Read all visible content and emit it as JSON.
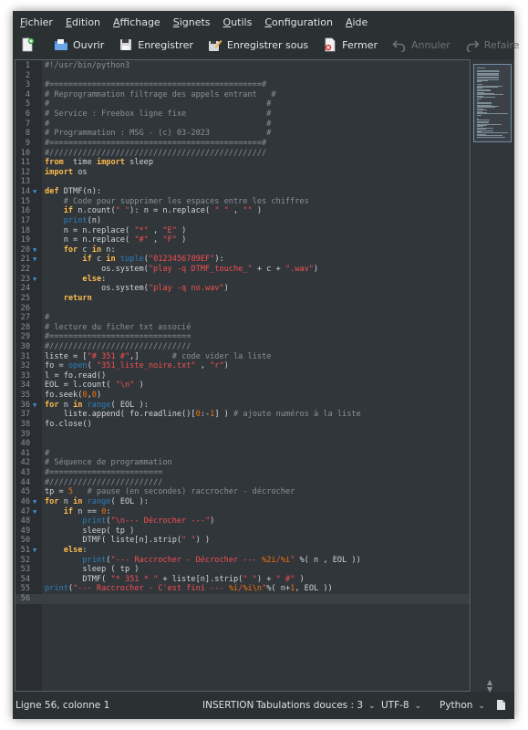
{
  "menu": [
    "Fichier",
    "Edition",
    "Affichage",
    "Signets",
    "Outils",
    "Configuration",
    "Aide"
  ],
  "toolbar": {
    "new": {
      "label": "",
      "icon": "new-document-icon"
    },
    "open": {
      "label": "Ouvrir",
      "icon": "open-folder-icon"
    },
    "save": {
      "label": "Enregistrer",
      "icon": "save-icon"
    },
    "save_as": {
      "label": "Enregistrer sous",
      "icon": "save-as-icon"
    },
    "close": {
      "label": "Fermer",
      "icon": "close-document-icon"
    },
    "undo": {
      "label": "Annuler",
      "icon": "undo-icon"
    },
    "redo": {
      "label": "Refaire",
      "icon": "redo-icon"
    }
  },
  "editor": {
    "current_line": 56,
    "lines": [
      {
        "n": "1",
        "t": [
          [
            "cm",
            "#!/usr/bin/python3"
          ]
        ]
      },
      {
        "n": "2",
        "t": []
      },
      {
        "n": "3",
        "t": [
          [
            "cm",
            "#=============================================#"
          ]
        ]
      },
      {
        "n": "4",
        "t": [
          [
            "cm",
            "# Reprogrammation filtrage des appels entrant   #"
          ]
        ]
      },
      {
        "n": "5",
        "t": [
          [
            "cm",
            "#                                              #"
          ]
        ]
      },
      {
        "n": "6",
        "t": [
          [
            "cm",
            "# Service : Freebox ligne fixe                 #"
          ]
        ]
      },
      {
        "n": "7",
        "t": [
          [
            "cm",
            "#                                              #"
          ]
        ]
      },
      {
        "n": "8",
        "t": [
          [
            "cm",
            "# Programmation : MSG - (c) 03-2023            #"
          ]
        ]
      },
      {
        "n": "9",
        "t": [
          [
            "cm",
            "#=============================================#"
          ]
        ]
      },
      {
        "n": "10",
        "t": [
          [
            "cm",
            "#//////////////////////////////////////////////"
          ]
        ]
      },
      {
        "n": "11",
        "t": [
          [
            "kw",
            "from"
          ],
          [
            "",
            "  time "
          ],
          [
            "kw",
            "import"
          ],
          [
            "",
            " sleep"
          ]
        ]
      },
      {
        "n": "12",
        "t": [
          [
            "kw",
            "import"
          ],
          [
            "",
            " os"
          ]
        ]
      },
      {
        "n": "13",
        "t": []
      },
      {
        "n": "14",
        "fold": true,
        "t": [
          [
            "kw",
            "def"
          ],
          [
            "",
            " DTMF(n):"
          ]
        ]
      },
      {
        "n": "15",
        "t": [
          [
            "",
            "    "
          ],
          [
            "cm",
            "# Code pour supprimer les espaces entre les chiffres"
          ]
        ]
      },
      {
        "n": "16",
        "t": [
          [
            "",
            "    "
          ],
          [
            "kw",
            "if"
          ],
          [
            "",
            " n.count("
          ],
          [
            "str",
            "\" \""
          ],
          [
            "",
            "): n = n.replace( "
          ],
          [
            "str",
            "\" \""
          ],
          [
            "",
            " , "
          ],
          [
            "str",
            "\"\""
          ],
          [
            "",
            " )"
          ]
        ]
      },
      {
        "n": "17",
        "t": [
          [
            "",
            "    "
          ],
          [
            "bi",
            "print"
          ],
          [
            "",
            "(n)"
          ]
        ]
      },
      {
        "n": "18",
        "t": [
          [
            "",
            "    n = n.replace( "
          ],
          [
            "str",
            "\"*\""
          ],
          [
            "",
            " , "
          ],
          [
            "str",
            "\"E\""
          ],
          [
            "",
            " )"
          ]
        ]
      },
      {
        "n": "19",
        "t": [
          [
            "",
            "    n = n.replace( "
          ],
          [
            "str",
            "\"#\""
          ],
          [
            "",
            " , "
          ],
          [
            "str",
            "\"F\""
          ],
          [
            "",
            " )"
          ]
        ]
      },
      {
        "n": "20",
        "fold": true,
        "t": [
          [
            "",
            "    "
          ],
          [
            "kw",
            "for"
          ],
          [
            "",
            " c "
          ],
          [
            "kw",
            "in"
          ],
          [
            "",
            " n:"
          ]
        ]
      },
      {
        "n": "21",
        "fold": true,
        "t": [
          [
            "",
            "        "
          ],
          [
            "kw",
            "if"
          ],
          [
            "",
            " c "
          ],
          [
            "kw",
            "in"
          ],
          [
            "",
            " "
          ],
          [
            "bi",
            "tuple"
          ],
          [
            "",
            "("
          ],
          [
            "str",
            "\"0123456789EF\""
          ],
          [
            "",
            "):"
          ]
        ]
      },
      {
        "n": "22",
        "t": [
          [
            "",
            "            os.system("
          ],
          [
            "str",
            "\"play -q DTMF_touche_\""
          ],
          [
            "",
            " + c + "
          ],
          [
            "str",
            "\".wav\""
          ],
          [
            "",
            ")"
          ]
        ]
      },
      {
        "n": "23",
        "fold": true,
        "t": [
          [
            "",
            "        "
          ],
          [
            "kw",
            "else"
          ],
          [
            "",
            ":"
          ]
        ]
      },
      {
        "n": "24",
        "t": [
          [
            "",
            "            os.system("
          ],
          [
            "str",
            "\"play -q no.wav\""
          ],
          [
            "",
            ")"
          ]
        ]
      },
      {
        "n": "25",
        "t": [
          [
            "",
            "    "
          ],
          [
            "kw",
            "return"
          ]
        ]
      },
      {
        "n": "26",
        "t": []
      },
      {
        "n": "27",
        "t": [
          [
            "cm",
            "#"
          ]
        ]
      },
      {
        "n": "28",
        "t": [
          [
            "cm",
            "# lecture du ficher txt associé"
          ]
        ]
      },
      {
        "n": "29",
        "t": [
          [
            "cm",
            "#=============================="
          ]
        ]
      },
      {
        "n": "30",
        "t": [
          [
            "cm",
            "#//////////////////////////////"
          ]
        ]
      },
      {
        "n": "31",
        "t": [
          [
            "",
            "liste = ["
          ],
          [
            "str",
            "\"# 351 #\""
          ],
          [
            "",
            ",]       "
          ],
          [
            "cm",
            "# code vider la liste"
          ]
        ]
      },
      {
        "n": "32",
        "t": [
          [
            "",
            "fo = "
          ],
          [
            "bi",
            "open"
          ],
          [
            "",
            "( "
          ],
          [
            "str",
            "\"351_liste_noire.txt\""
          ],
          [
            "",
            " , "
          ],
          [
            "str",
            "\"r\""
          ],
          [
            "",
            ")"
          ]
        ]
      },
      {
        "n": "33",
        "t": [
          [
            "",
            "l = fo.read()"
          ]
        ]
      },
      {
        "n": "34",
        "t": [
          [
            "",
            "EOL = l.count( "
          ],
          [
            "str",
            "\"\\n\""
          ],
          [
            "",
            " )"
          ]
        ]
      },
      {
        "n": "35",
        "t": [
          [
            "",
            "fo.seek("
          ],
          [
            "num",
            "0"
          ],
          [
            "",
            ","
          ],
          [
            "num",
            "0"
          ],
          [
            "",
            ")"
          ]
        ]
      },
      {
        "n": "36",
        "fold": true,
        "t": [
          [
            "kw",
            "for"
          ],
          [
            "",
            " n "
          ],
          [
            "kw",
            "in"
          ],
          [
            "",
            " "
          ],
          [
            "bi",
            "range"
          ],
          [
            "",
            "( EOL ):"
          ]
        ]
      },
      {
        "n": "37",
        "t": [
          [
            "",
            "    liste.append( fo.readline()["
          ],
          [
            "num",
            "0"
          ],
          [
            "",
            ":-"
          ],
          [
            "num",
            "1"
          ],
          [
            "",
            "] ) "
          ],
          [
            "cm",
            "# ajoute numéros à la liste"
          ]
        ]
      },
      {
        "n": "38",
        "t": [
          [
            "",
            "fo.close()"
          ]
        ]
      },
      {
        "n": "39",
        "t": []
      },
      {
        "n": "40",
        "t": []
      },
      {
        "n": "41",
        "t": [
          [
            "cm",
            "#"
          ]
        ]
      },
      {
        "n": "42",
        "t": [
          [
            "cm",
            "# Séquence de programmation"
          ]
        ]
      },
      {
        "n": "43",
        "t": [
          [
            "cm",
            "#========================"
          ]
        ]
      },
      {
        "n": "44",
        "t": [
          [
            "cm",
            "#////////////////////////"
          ]
        ]
      },
      {
        "n": "45",
        "t": [
          [
            "",
            "tp = "
          ],
          [
            "num",
            "5"
          ],
          [
            "",
            "   "
          ],
          [
            "cm",
            "# pause (en secondes) raccrocher - décrocher"
          ]
        ]
      },
      {
        "n": "46",
        "fold": true,
        "t": [
          [
            "kw",
            "for"
          ],
          [
            "",
            " n "
          ],
          [
            "kw",
            "in"
          ],
          [
            "",
            " "
          ],
          [
            "bi",
            "range"
          ],
          [
            "",
            "( EOL ):"
          ]
        ]
      },
      {
        "n": "47",
        "fold": true,
        "t": [
          [
            "",
            "    "
          ],
          [
            "kw",
            "if"
          ],
          [
            "",
            " n == "
          ],
          [
            "num",
            "0"
          ],
          [
            "",
            ":"
          ]
        ]
      },
      {
        "n": "48",
        "t": [
          [
            "",
            "        "
          ],
          [
            "bi",
            "print"
          ],
          [
            "",
            "("
          ],
          [
            "str",
            "\"\\n--- Décrocher ---\""
          ],
          [
            "",
            ")"
          ]
        ]
      },
      {
        "n": "49",
        "t": [
          [
            "",
            "        sleep( tp )"
          ]
        ]
      },
      {
        "n": "50",
        "t": [
          [
            "",
            "        DTMF( liste[n].strip("
          ],
          [
            "str",
            "\" \""
          ],
          [
            "",
            ") )"
          ]
        ]
      },
      {
        "n": "51",
        "fold": true,
        "t": [
          [
            "",
            "    "
          ],
          [
            "kw",
            "else"
          ],
          [
            "",
            ":"
          ]
        ]
      },
      {
        "n": "52",
        "t": [
          [
            "",
            "        "
          ],
          [
            "bi",
            "print"
          ],
          [
            "",
            "("
          ],
          [
            "str",
            "\"--- Raccrocher - Décrocher --- "
          ],
          [
            "num",
            "%2i"
          ],
          [
            "str",
            "/"
          ],
          [
            "num",
            "%i"
          ],
          [
            "str",
            "\""
          ],
          [
            "",
            " %( n , EOL ))"
          ]
        ]
      },
      {
        "n": "53",
        "t": [
          [
            "",
            "        sleep ( tp )"
          ]
        ]
      },
      {
        "n": "54",
        "t": [
          [
            "",
            "        DTMF( "
          ],
          [
            "str",
            "\"* 351 * \""
          ],
          [
            "",
            " + liste[n].strip("
          ],
          [
            "str",
            "\" \""
          ],
          [
            "",
            ") + "
          ],
          [
            "str",
            "\" #\""
          ],
          [
            "",
            " )"
          ]
        ]
      },
      {
        "n": "55",
        "t": [
          [
            "bi",
            "print"
          ],
          [
            "",
            "("
          ],
          [
            "str",
            "\"--- Raccrocher - C'est fini --- "
          ],
          [
            "num",
            "%i"
          ],
          [
            "str",
            "/"
          ],
          [
            "num",
            "%i\\n"
          ],
          [
            "str",
            "\""
          ],
          [
            "",
            "%( n+"
          ],
          [
            "num",
            "1"
          ],
          [
            "",
            ", EOL ))"
          ]
        ]
      },
      {
        "n": "56",
        "t": []
      }
    ]
  },
  "status": {
    "position": "Ligne 56, colonne 1",
    "mode": "INSERTION",
    "indent": "Tabulations douces : 3",
    "encoding": "UTF-8",
    "language": "Python"
  },
  "colors": {
    "background": "#31363b",
    "keyword": "#fdbc4b",
    "string": "#f44f4f",
    "number": "#f67400",
    "comment": "#8a9196",
    "builtin": "#2980b9",
    "fold_marker": "#3e8fd1"
  }
}
